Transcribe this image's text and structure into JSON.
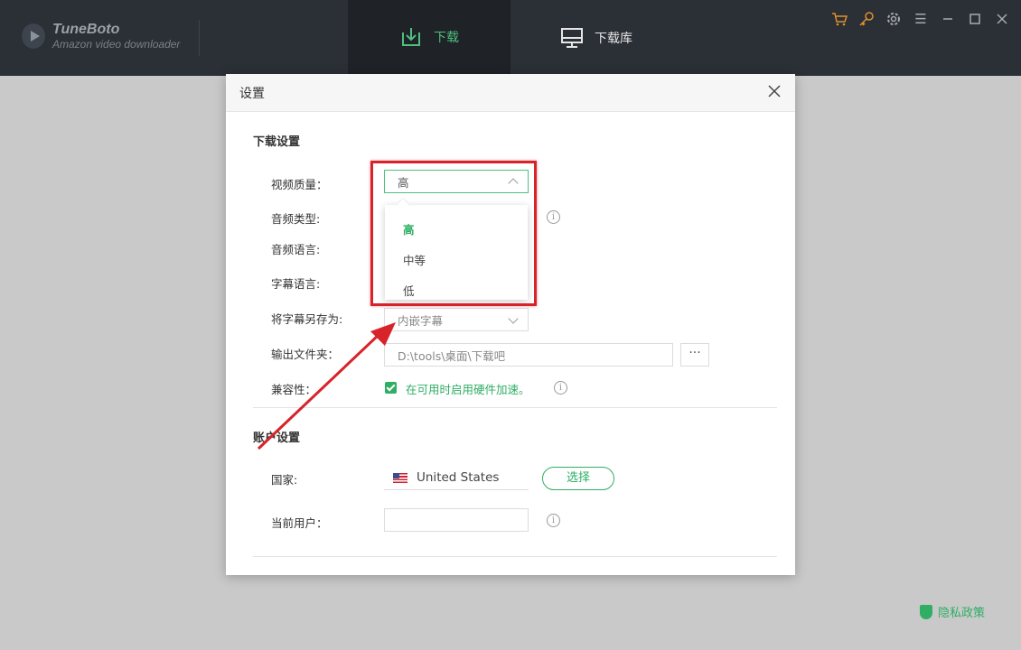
{
  "app": {
    "title": "TuneBoto",
    "subtitle": "Amazon video downloader"
  },
  "tabs": [
    {
      "label": "下载",
      "icon": "download-icon",
      "active": true
    },
    {
      "label": "下载库",
      "icon": "monitor-icon",
      "active": false
    }
  ],
  "window_controls": [
    "cart-icon",
    "key-icon",
    "gear-icon",
    "menu-icon",
    "minimize-icon",
    "maximize-icon",
    "close-icon"
  ],
  "dialog": {
    "title": "设置",
    "download_section": {
      "title": "下载设置",
      "video_quality": {
        "label": "视频质量：",
        "value": "高",
        "options": [
          "高",
          "中等",
          "低"
        ]
      },
      "audio_type": {
        "label": "音频类型:"
      },
      "audio_language": {
        "label": "音频语言:"
      },
      "subtitle_language": {
        "label": "字幕语言:"
      },
      "save_subtitle_as": {
        "label": "将字幕另存为:",
        "value": "内嵌字幕"
      },
      "output_folder": {
        "label": "输出文件夹：",
        "value": "D:\\tools\\桌面\\下载吧",
        "browse": "···"
      },
      "compatibility": {
        "label": "兼容性：",
        "option": "在可用时启用硬件加速。",
        "checked": true
      }
    },
    "account_section": {
      "title": "账户设置",
      "country": {
        "label": "国家:",
        "value": "United States",
        "button": "选择"
      },
      "current_user": {
        "label": "当前用户：",
        "value": ""
      }
    }
  },
  "footer": {
    "privacy": "隐私政策"
  },
  "colors": {
    "accent_green": "#2fae64",
    "topbar": "#2b2f36",
    "highlight_red": "#d8232a"
  }
}
